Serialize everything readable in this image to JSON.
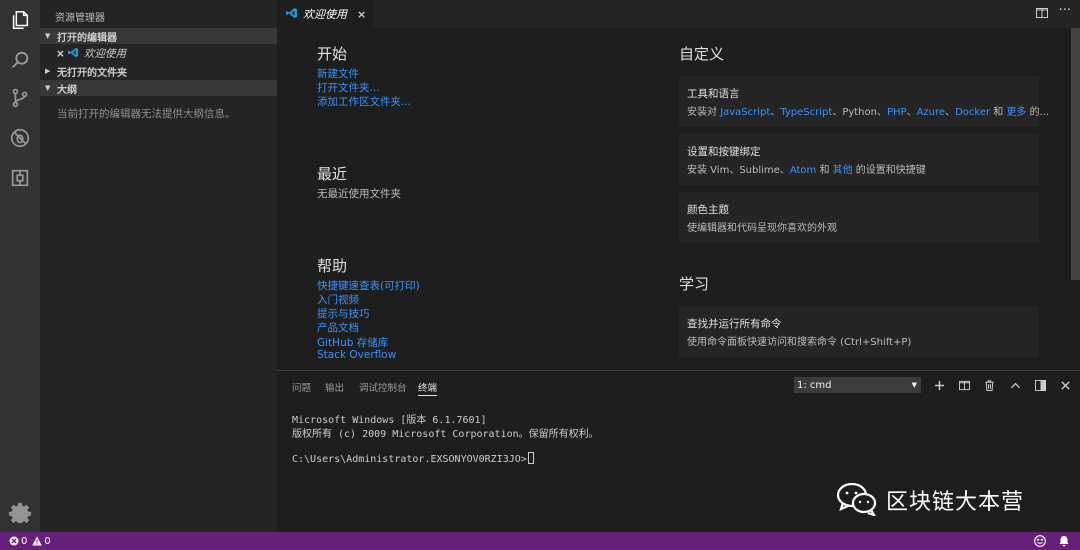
{
  "sidebar": {
    "title": "资源管理器",
    "open_editors": {
      "label": "打开的编辑器",
      "file": "欢迎使用"
    },
    "no_folder": {
      "label": "无打开的文件夹"
    },
    "outline": {
      "label": "大纲",
      "message": "当前打开的编辑器无法提供大纲信息。"
    }
  },
  "tab": {
    "label": "欢迎使用",
    "close": "×"
  },
  "welcome": {
    "start": {
      "heading": "开始",
      "links": [
        "新建文件",
        "打开文件夹...",
        "添加工作区文件夹..."
      ]
    },
    "recent": {
      "heading": "最近",
      "empty": "无最近使用文件夹"
    },
    "help": {
      "heading": "帮助",
      "links": [
        "快捷键速查表(可打印)",
        "入门视频",
        "提示与技巧",
        "产品文档",
        "GitHub 存储库",
        "Stack Overflow"
      ]
    },
    "customize": {
      "heading": "自定义",
      "cards": [
        {
          "title": "工具和语言",
          "pre": "安装对 ",
          "links": [
            "JavaScript",
            "TypeScript",
            "Python",
            "PHP",
            "Azure",
            "Docker"
          ],
          "sep": "、",
          "and": " 和 ",
          "more": "更多",
          "post": " 的..."
        },
        {
          "title": "设置和按键绑定",
          "pre": "安装 Vim、Sublime、",
          "link1": "Atom",
          "and": " 和 ",
          "link2": "其他",
          "post": " 的设置和快捷键"
        },
        {
          "title": "颜色主题",
          "desc": "使编辑器和代码呈现你喜欢的外观"
        }
      ]
    },
    "learn": {
      "heading": "学习",
      "cards": [
        {
          "title": "查找并运行所有命令",
          "desc": "使用命令面板快速访问和搜索命令 (Ctrl+Shift+P)"
        }
      ]
    }
  },
  "panel": {
    "tabs": [
      "问题",
      "输出",
      "调试控制台",
      "终端"
    ],
    "active_tab": "终端",
    "terminal_select": "1: cmd",
    "terminal_lines": [
      "Microsoft Windows [版本 6.1.7601]",
      "版权所有 (c) 2009 Microsoft Corporation。保留所有权利。",
      "",
      "C:\\Users\\Administrator.EXSONYOV0RZI3JO>"
    ]
  },
  "watermark": {
    "text": "区块链大本营"
  },
  "statusbar": {
    "errors": "0",
    "warnings": "0"
  },
  "colors": {
    "statusbar": "#68217a",
    "activity_bar": "#333333",
    "sidebar": "#252526",
    "editor": "#1e1e1e",
    "link": "#3794ff",
    "vscode_icon": "#1e9ad6"
  }
}
